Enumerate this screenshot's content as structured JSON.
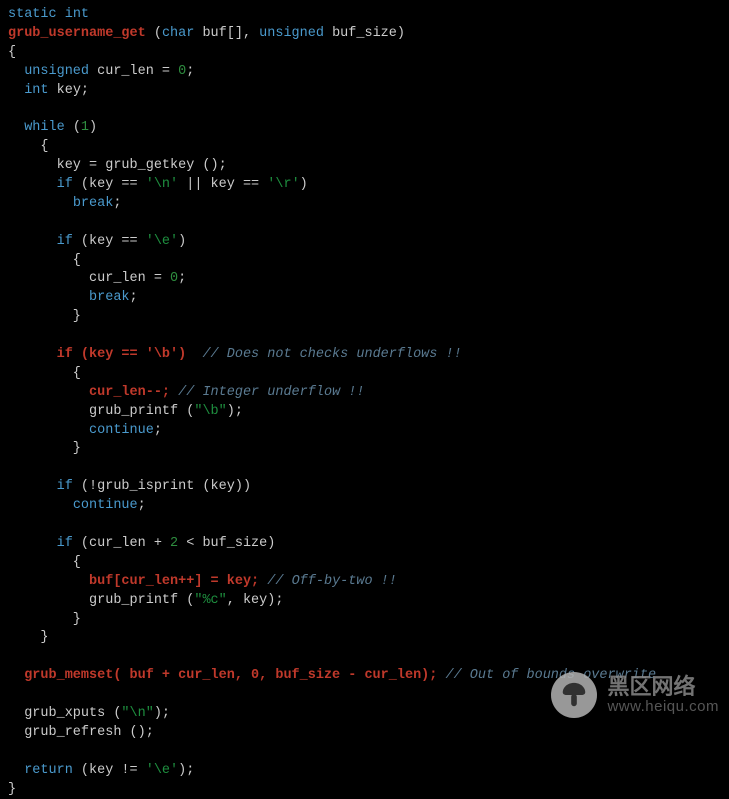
{
  "code": {
    "l01a": "static",
    "l01b": "int",
    "l02a": "grub_username_get",
    "l02b": " (",
    "l02c": "char",
    "l02d": " buf[], ",
    "l02e": "unsigned",
    "l02f": " buf_size)",
    "l03": "{",
    "l04a": "  ",
    "l04b": "unsigned",
    "l04c": " cur_len = ",
    "l04d": "0",
    "l04e": ";",
    "l05a": "  ",
    "l05b": "int",
    "l05c": " key;",
    "l06": " ",
    "l07a": "  ",
    "l07b": "while",
    "l07c": " (",
    "l07d": "1",
    "l07e": ")",
    "l08": "    {",
    "l09": "      key = grub_getkey ();",
    "l10a": "      ",
    "l10b": "if",
    "l10c": " (key == ",
    "l10d": "'\\n'",
    "l10e": " || key == ",
    "l10f": "'\\r'",
    "l10g": ")",
    "l11a": "        ",
    "l11b": "break",
    "l11c": ";",
    "l12": " ",
    "l13a": "      ",
    "l13b": "if",
    "l13c": " (key == ",
    "l13d": "'\\e'",
    "l13e": ")",
    "l14": "        {",
    "l15a": "          cur_len = ",
    "l15b": "0",
    "l15c": ";",
    "l16a": "          ",
    "l16b": "break",
    "l16c": ";",
    "l17": "        }",
    "l18": " ",
    "l19a": "      ",
    "l19b": "if (key == '\\b')",
    "l19c": "  ",
    "l19d": "// Does not checks underflows !!",
    "l20": "        {",
    "l21a": "          ",
    "l21b": "cur_len--;",
    "l21c": " ",
    "l21d": "// Integer underflow !!",
    "l22a": "          grub_printf (",
    "l22b": "\"\\b\"",
    "l22c": ");",
    "l23a": "          ",
    "l23b": "continue",
    "l23c": ";",
    "l24": "        }",
    "l25": " ",
    "l26a": "      ",
    "l26b": "if",
    "l26c": " (!grub_isprint (key))",
    "l27a": "        ",
    "l27b": "continue",
    "l27c": ";",
    "l28": " ",
    "l29a": "      ",
    "l29b": "if",
    "l29c": " (cur_len + ",
    "l29d": "2",
    "l29e": " < buf_size)",
    "l30": "        {",
    "l31a": "          ",
    "l31b": "buf[cur_len++] = key;",
    "l31c": " ",
    "l31d": "// Off-by-two !!",
    "l32a": "          grub_printf (",
    "l32b": "\"%c\"",
    "l32c": ", key);",
    "l33": "        }",
    "l34": "    }",
    "l35": " ",
    "l36a": "  ",
    "l36b": "grub_memset( buf + cur_len, 0, buf_size - cur_len);",
    "l36c": " ",
    "l36d": "// Out of bounds overwrite",
    "l37": " ",
    "l38a": "  grub_xputs (",
    "l38b": "\"\\n\"",
    "l38c": ");",
    "l39": "  grub_refresh ();",
    "l40": " ",
    "l41a": "  ",
    "l41b": "return",
    "l41c": " (key != ",
    "l41d": "'\\e'",
    "l41e": ");",
    "l42": "}"
  },
  "watermark": {
    "line1": "黑区网络",
    "line2": "www.heiqu.com"
  }
}
